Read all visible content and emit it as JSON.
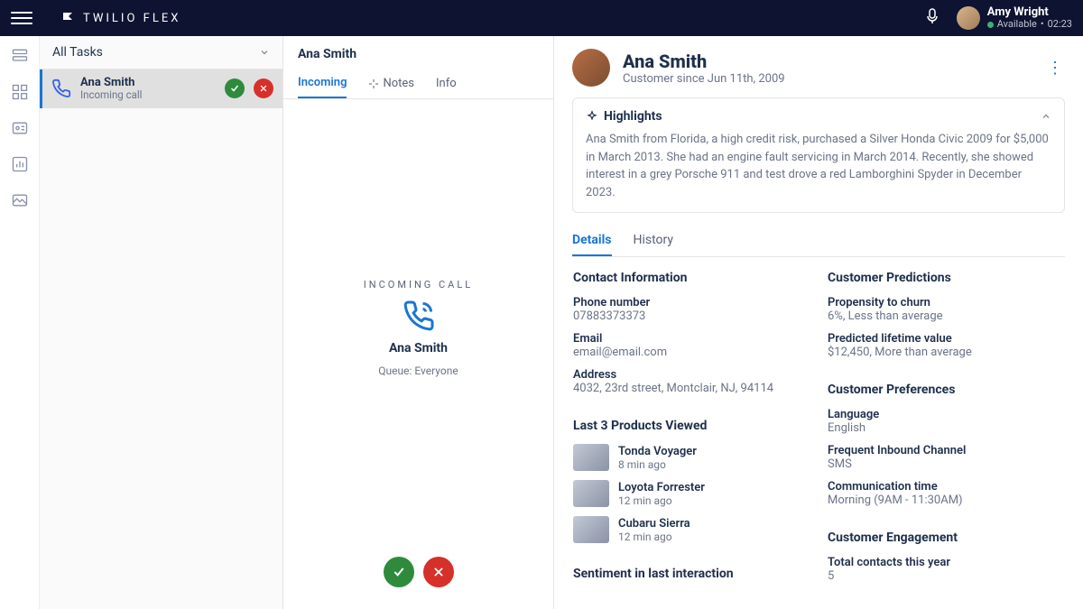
{
  "header": {
    "brand": "TWILIO FLEX",
    "user_name": "Amy Wright",
    "status_label": "Available",
    "status_time": "02:23"
  },
  "tasks": {
    "header": "All Tasks",
    "item_name": "Ana Smith",
    "item_sub": "Incoming call"
  },
  "call": {
    "header_name": "Ana Smith",
    "tabs": {
      "incoming": "Incoming",
      "notes": "Notes",
      "info": "Info"
    },
    "incoming_label": "INCOMING CALL",
    "caller": "Ana Smith",
    "queue": "Queue: Everyone"
  },
  "detail": {
    "name": "Ana Smith",
    "since": "Customer since Jun 11th, 2009",
    "highlights_label": "Highlights",
    "highlights_text": "Ana Smith from Florida, a high credit risk, purchased a Silver Honda Civic 2009 for $5,000 in March 2013. She had an engine fault servicing in March 2014. Recently, she showed interest in a grey Porsche 911 and test drove a red Lamborghini Spyder in December 2023.",
    "subtabs": {
      "details": "Details",
      "history": "History"
    },
    "contact": {
      "title": "Contact Information",
      "phone_label": "Phone number",
      "phone_value": "07883373373",
      "email_label": "Email",
      "email_value": "email@email.com",
      "address_label": "Address",
      "address_value": "4032, 23rd street, Montclair, NJ, 94114"
    },
    "products": {
      "title": "Last 3 Products Viewed",
      "items": [
        {
          "name": "Tonda Voyager",
          "time": "8 min ago"
        },
        {
          "name": "Loyota Forrester",
          "time": "12 min ago"
        },
        {
          "name": "Cubaru Sierra",
          "time": "12 min ago"
        }
      ]
    },
    "sentiment_title": "Sentiment in last interaction",
    "predictions": {
      "title": "Customer Predictions",
      "churn_label": "Propensity to churn",
      "churn_value": "6%, Less than average",
      "plv_label": "Predicted lifetime value",
      "plv_value": "$12,450, More than average"
    },
    "prefs": {
      "title": "Customer Preferences",
      "lang_label": "Language",
      "lang_value": "English",
      "channel_label": "Frequent Inbound Channel",
      "channel_value": "SMS",
      "comm_label": "Communication time",
      "comm_value": "Morning (9AM - 11:30AM)"
    },
    "engagement": {
      "title": "Customer Engagement",
      "contacts_label": "Total contacts this year",
      "contacts_value": "5"
    }
  }
}
